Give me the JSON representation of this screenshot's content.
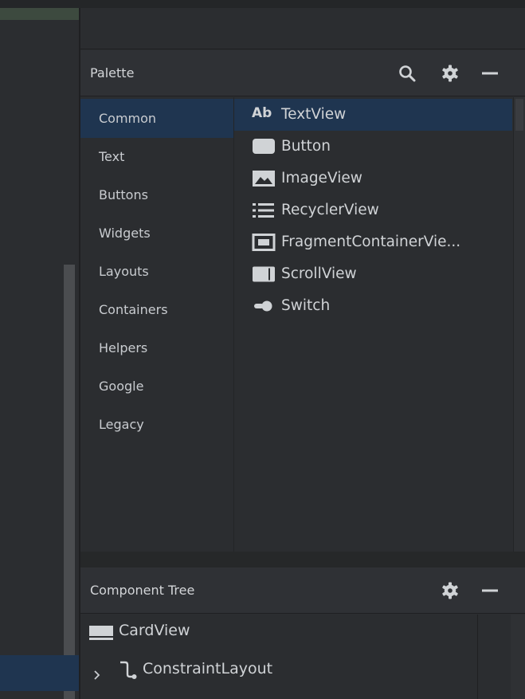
{
  "palette": {
    "title": "Palette",
    "icons": [
      "search-icon",
      "gear-icon",
      "minimize-icon"
    ],
    "categories": [
      {
        "label": "Common",
        "selected": true
      },
      {
        "label": "Text"
      },
      {
        "label": "Buttons"
      },
      {
        "label": "Widgets"
      },
      {
        "label": "Layouts"
      },
      {
        "label": "Containers"
      },
      {
        "label": "Helpers"
      },
      {
        "label": "Google"
      },
      {
        "label": "Legacy"
      }
    ],
    "components": [
      {
        "label": "TextView",
        "icon": "textview-icon",
        "icon_text": "Ab",
        "selected": true
      },
      {
        "label": "Button",
        "icon": "button-icon"
      },
      {
        "label": "ImageView",
        "icon": "image-icon"
      },
      {
        "label": "RecyclerView",
        "icon": "list-icon"
      },
      {
        "label": "FragmentContainerVie...",
        "icon": "fragment-container-icon"
      },
      {
        "label": "ScrollView",
        "icon": "scrollview-icon"
      },
      {
        "label": "Switch",
        "icon": "switch-icon"
      }
    ]
  },
  "component_tree": {
    "title": "Component Tree",
    "icons": [
      "gear-icon",
      "minimize-icon"
    ],
    "nodes": [
      {
        "label": "CardView",
        "icon": "cardview-icon"
      },
      {
        "label": "ConstraintLayout",
        "icon": "constraint-layout-icon",
        "expandable": true
      }
    ]
  },
  "colors": {
    "background": "#2b2d30",
    "selection": "#1f3550",
    "text": "#c9ccd0",
    "icon": "#d0d3d6"
  }
}
